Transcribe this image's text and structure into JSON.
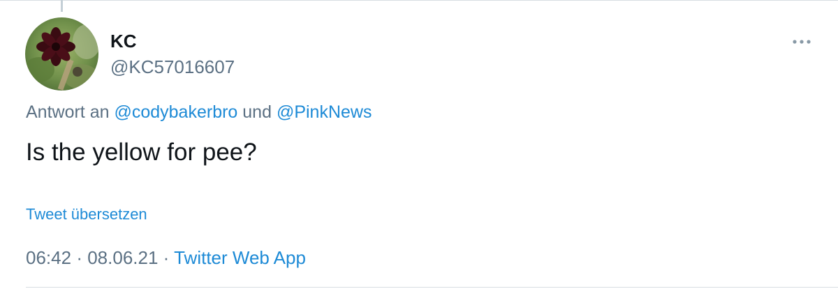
{
  "tweet": {
    "author": {
      "name": "KC",
      "handle": "@KC57016607",
      "avatar_icon": "flower-avatar-icon"
    },
    "reply_to": {
      "prefix": "Antwort an",
      "mention_1": "@codybakerbro",
      "conjunction": "und",
      "mention_2": "@PinkNews"
    },
    "text": "Is the yellow for pee?",
    "translate_label": "Tweet übersetzen",
    "meta": {
      "time": "06:42",
      "separator": "·",
      "date": "08.06.21",
      "source": "Twitter Web App"
    },
    "more_icon": "more-dots-icon"
  },
  "colors": {
    "link": "#1d8ad6",
    "secondary_text": "#5b7083",
    "primary_text": "#0f1419",
    "divider": "#d7dde2"
  }
}
